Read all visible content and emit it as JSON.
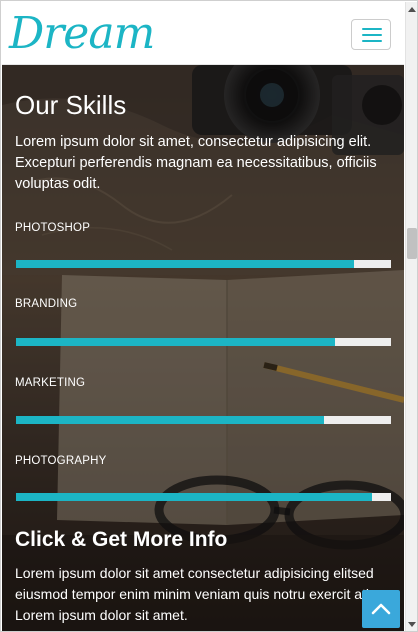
{
  "header": {
    "logo_text": "Dream",
    "menu_icon": "hamburger-menu-icon"
  },
  "skills_section": {
    "title": "Our Skills",
    "intro": "Lorem ipsum dolor sit amet, consectetur adipisicing elit. Excepturi perferendis magnam ea necessitatibus, officiis voluptas odit.",
    "skills": [
      {
        "label": "PHOTOSHOP",
        "level": 0.9
      },
      {
        "label": "BRANDING",
        "level": 0.85
      },
      {
        "label": "MARKETING",
        "level": 0.82
      },
      {
        "label": "PHOTOGRAPHY",
        "level": 0.95
      }
    ]
  },
  "info_section": {
    "title": "Click & Get More Info",
    "text": "Lorem ipsum dolor sit amet consectetur adipisicing elitsed eiusmod tempor enim minim veniam quis notru exercit ation Lorem ipsum dolor sit amet."
  },
  "back_to_top": {
    "icon": "chevron-up-icon"
  },
  "colors": {
    "accent": "#1cb5c5",
    "track": "#eeeeee",
    "back_to_top": "#3aa8db"
  }
}
